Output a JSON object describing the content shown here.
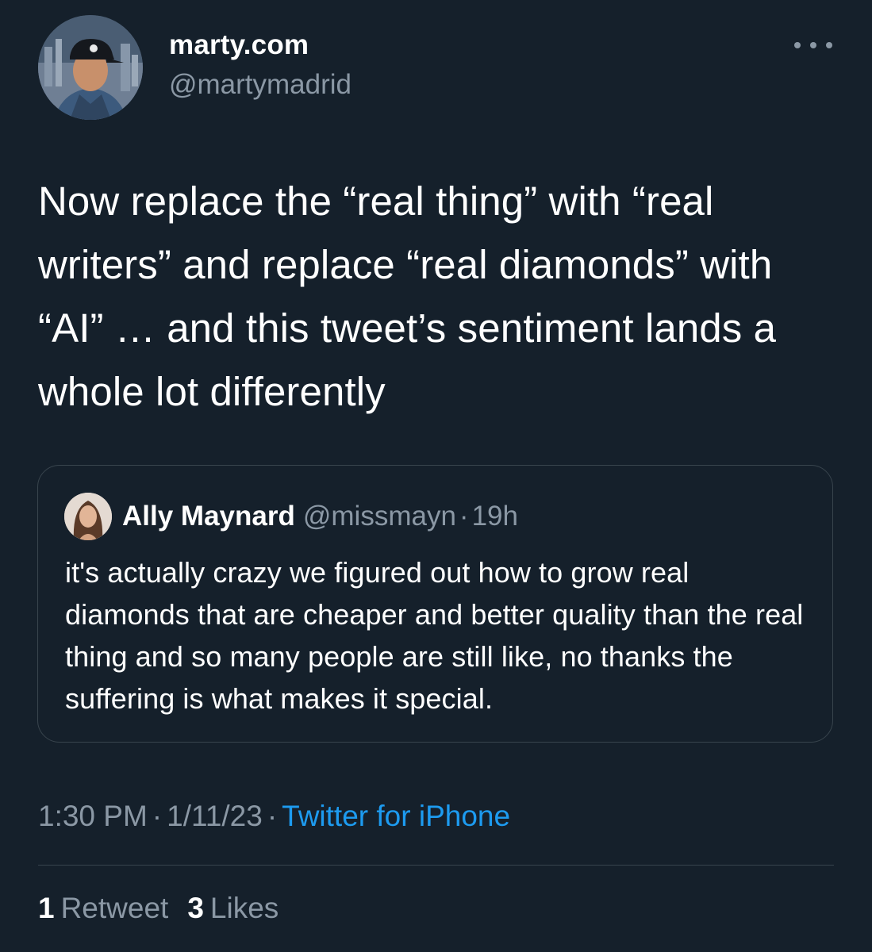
{
  "tweet": {
    "author": {
      "name": "marty.com",
      "handle": "@martymadrid"
    },
    "text": "Now replace the “real thing” with “real writers” and replace “real diamonds” with “AI” … and this tweet’s sentiment lands a whole lot differently",
    "quoted": {
      "name": "Ally Maynard",
      "handle": "@missmayn",
      "separator": "·",
      "time": "19h",
      "text": "it's actually crazy we figured out how to grow real diamonds that are cheaper and better quality than the real thing and so many people are still like, no thanks the suffering is what makes it special."
    },
    "meta": {
      "time": "1:30 PM",
      "date": "1/11/23",
      "separator": "·",
      "source": "Twitter for iPhone"
    },
    "stats": {
      "retweets_count": "1",
      "retweets_label": "Retweet",
      "likes_count": "3",
      "likes_label": "Likes"
    }
  },
  "icons": {
    "more": "more-horizontal-icon"
  },
  "colors": {
    "background": "#15202b",
    "secondary_text": "#8b98a5",
    "link": "#1d9bf0",
    "border": "#38444d"
  }
}
